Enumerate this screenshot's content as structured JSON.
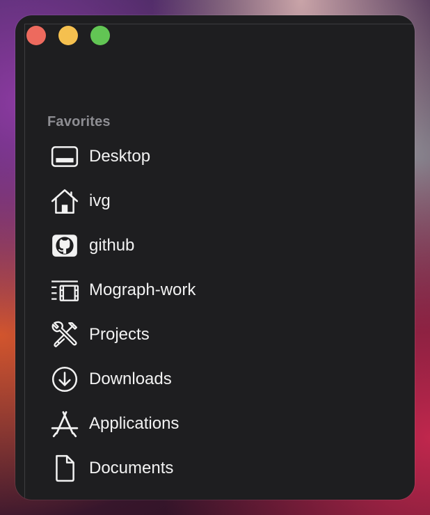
{
  "window": {
    "traffic_lights": {
      "close_color": "#ed6a5e",
      "minimize_color": "#f5c04f",
      "zoom_color": "#62c554"
    }
  },
  "sidebar": {
    "section_title": "Favorites",
    "items": [
      {
        "label": "Desktop",
        "icon": "desktop-icon"
      },
      {
        "label": "ivg",
        "icon": "home-icon"
      },
      {
        "label": "github",
        "icon": "github-icon"
      },
      {
        "label": "Mograph-work",
        "icon": "film-list-icon"
      },
      {
        "label": "Projects",
        "icon": "tools-icon"
      },
      {
        "label": "Downloads",
        "icon": "download-icon"
      },
      {
        "label": "Applications",
        "icon": "app-store-icon"
      },
      {
        "label": "Documents",
        "icon": "document-icon"
      }
    ]
  }
}
